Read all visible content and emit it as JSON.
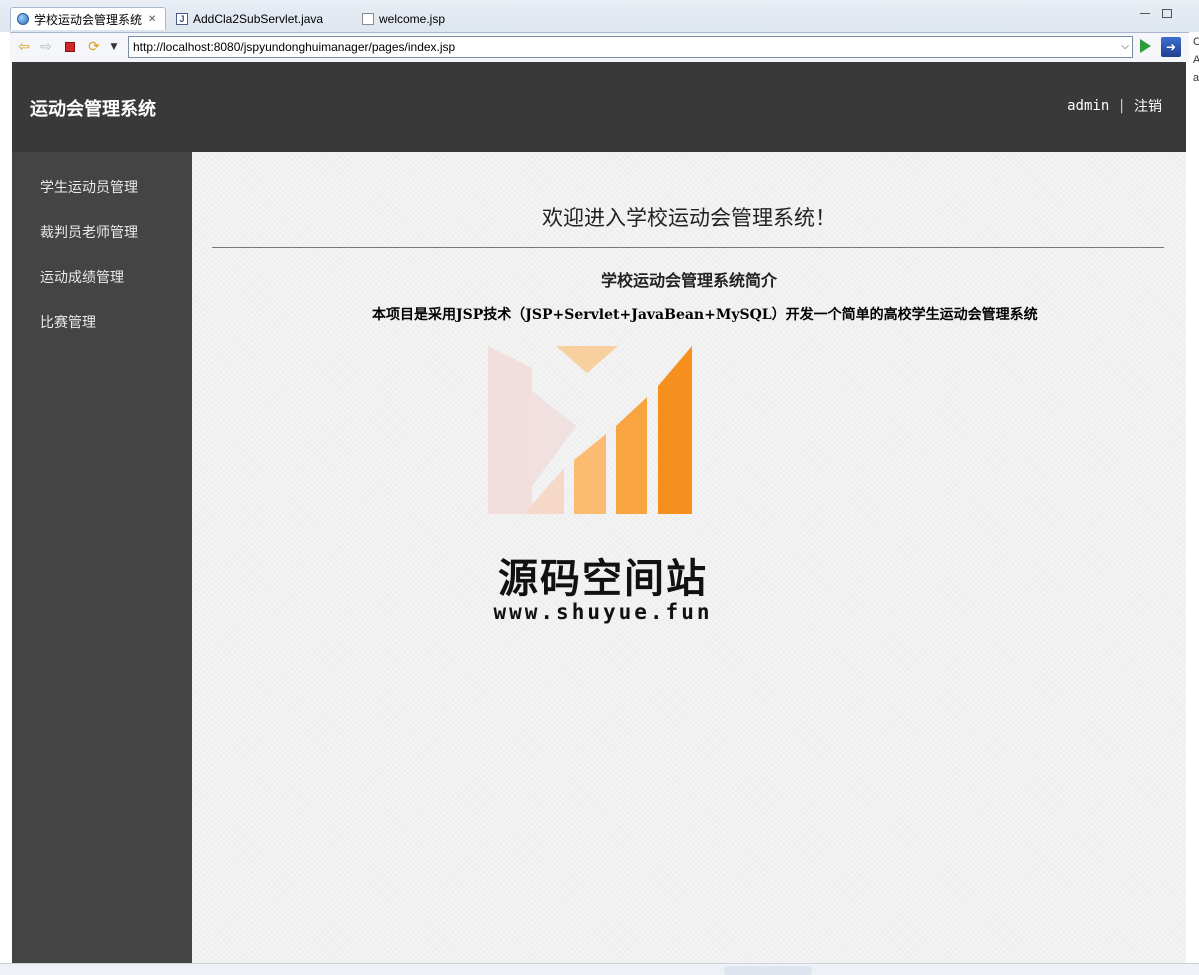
{
  "tabs": [
    {
      "label": "学校运动会管理系统",
      "close": "✕"
    },
    {
      "label": "AddCla2SubServlet.java"
    },
    {
      "label": "welcome.jsp"
    }
  ],
  "browser": {
    "url": "http://localhost:8080/jspyundonghuimanager/pages/index.jsp",
    "side_letters": [
      "C",
      "A",
      "a"
    ]
  },
  "header": {
    "brand": "运动会管理系统",
    "user": "admin",
    "separator": "|",
    "logout": "注销"
  },
  "sidebar": {
    "items": [
      {
        "label": "学生运动员管理"
      },
      {
        "label": "裁判员老师管理"
      },
      {
        "label": "运动成绩管理"
      },
      {
        "label": "比赛管理"
      }
    ]
  },
  "main": {
    "welcome": "欢迎进入学校运动会管理系统！",
    "intro_title": "学校运动会管理系统简介",
    "intro_text": "本项目是采用JSP技术（JSP+Servlet+JavaBean+MySQL）开发一个简单的高校学生运动会管理系统"
  },
  "watermark": {
    "title": "源码空间站",
    "url": "www.shuyue.fun"
  },
  "colors": {
    "header_bg": "#393939",
    "sidebar_bg": "#444444",
    "accent_orange": "#f5901e"
  }
}
